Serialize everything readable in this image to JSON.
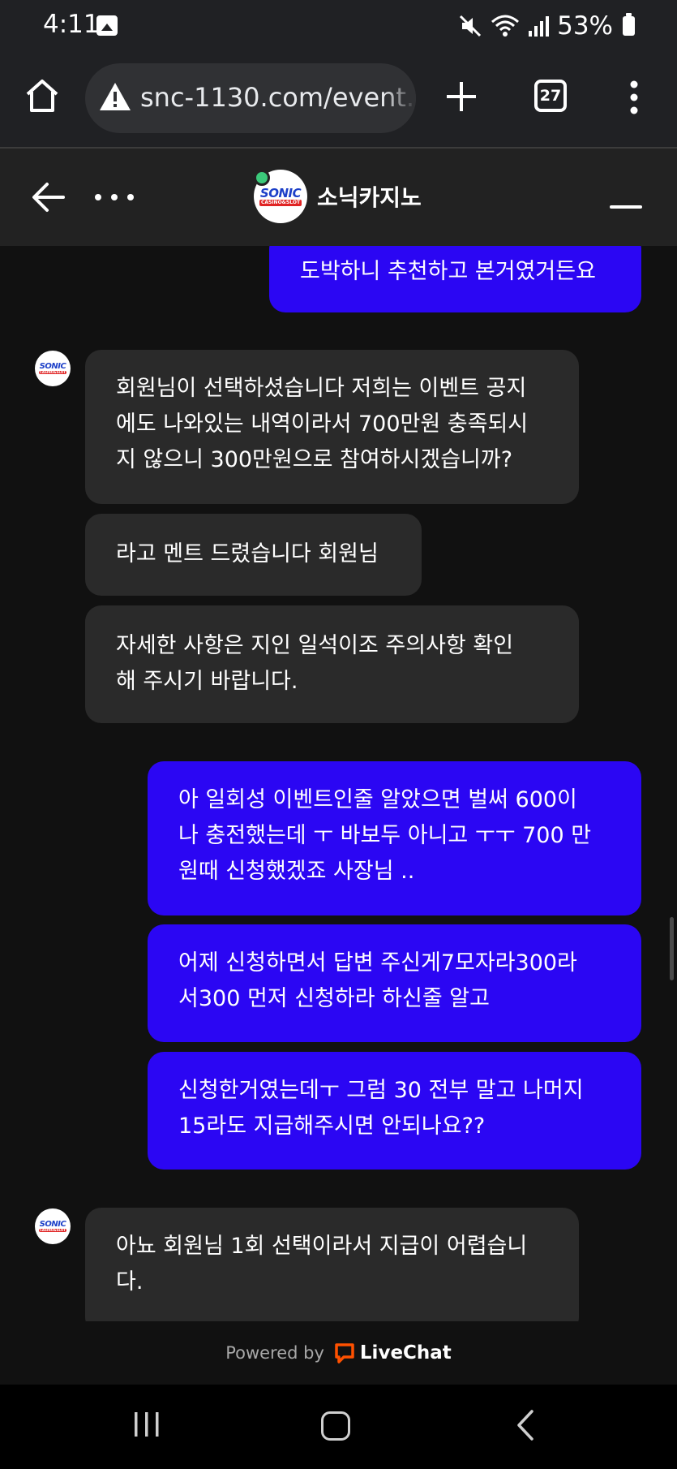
{
  "status_bar": {
    "time": "4:11",
    "battery": "53%",
    "icons": [
      "gallery-icon",
      "mute-icon",
      "wifi-icon",
      "signal-icon",
      "battery-icon"
    ]
  },
  "browser": {
    "url": "snc-1130.com/event.",
    "tab_count": "27",
    "icons": [
      "home-icon",
      "warning-icon",
      "plus-icon",
      "tabs-icon",
      "more-vert-icon"
    ]
  },
  "chat_header": {
    "brand_name": "소닉카지노",
    "logo_text": "SONIC",
    "logo_sub": "CASINO&SLOT",
    "online_color": "#3bc97a"
  },
  "messages": [
    {
      "from": "visitor",
      "text": "도박하니 추천하고 본거였거든요"
    },
    {
      "from": "agent",
      "text": "회원님이 선택하셨습니다 저희는 이벤트 공지\n에도 나와있는 내역이라서 700만원 충족되시\n지 않으니 300만원으로 참여하시겠습니까?"
    },
    {
      "from": "agent",
      "text": "라고 멘트 드렸습니다 회원님"
    },
    {
      "from": "agent",
      "text": "자세한 사항은 지인 일석이조 주의사항 확인\n해 주시기 바랍니다."
    },
    {
      "from": "visitor",
      "text": "아 일회성 이벤트인줄 알았으면 벌써 600이\n나 충전했는데 ㅜ 바보두 아니고 ㅜㅜ 700 만\n원때 신청했겠죠 사장님 .."
    },
    {
      "from": "visitor",
      "text": "어제 신청하면서 답변 주신게7모자라300라\n서300 먼저 신청하라 하신줄 알고"
    },
    {
      "from": "visitor",
      "text": "신청한거였는데ㅜ 그럼 30 전부 말고 나머지\n15라도 지급해주시면 안되나요??"
    },
    {
      "from": "agent",
      "text": "아뇨 회원님 1회 선택이라서 지급이 어렵습니\n다."
    }
  ],
  "footer": {
    "powered_by": "Powered by",
    "brand": "LiveChat",
    "brand_color": "#ff5100"
  },
  "colors": {
    "visitor_bubble": "#2b06f3",
    "agent_bubble": "#2a2a2a",
    "background": "#111111"
  }
}
